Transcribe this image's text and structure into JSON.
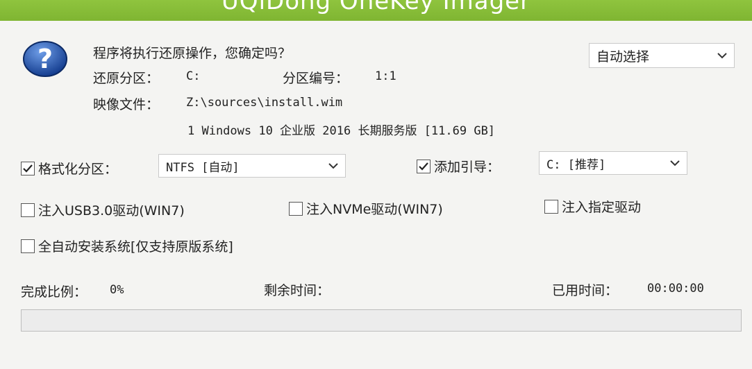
{
  "window": {
    "title": "UQiDong OneKey Imager"
  },
  "dialog": {
    "icon": "question-icon",
    "question": "程序将执行还原操作，您确定吗？",
    "restore_partition_label": "还原分区：",
    "restore_partition_value": "C:",
    "partition_number_label": "分区编号：",
    "partition_number_value": "1:1",
    "image_file_label": "映像文件：",
    "image_file_value": "Z:\\sources\\install.wim",
    "image_detail": "1 Windows 10 企业版 2016 长期服务版 [11.69 GB]",
    "auto_select": {
      "value": "自动选择"
    }
  },
  "options": {
    "format_partition": {
      "label": "格式化分区：",
      "checked": true,
      "select_value": "NTFS [自动]"
    },
    "add_boot": {
      "label": "添加引导：",
      "checked": true,
      "select_value": "C: [推荐]"
    },
    "inject_usb3": {
      "label": "注入USB3.0驱动(WIN7)",
      "checked": false
    },
    "inject_nvme": {
      "label": "注入NVMe驱动(WIN7)",
      "checked": false
    },
    "inject_custom": {
      "label": "注入指定驱动",
      "checked": false
    },
    "auto_install": {
      "label": "全自动安装系统[仅支持原版系统]",
      "checked": false
    }
  },
  "status": {
    "completion_label": "完成比例：",
    "completion_value": "0%",
    "remaining_label": "剩余时间：",
    "remaining_value": "",
    "elapsed_label": "已用时间：",
    "elapsed_value": "00:00:00",
    "progress_percent": 0
  },
  "colors": {
    "titlebar": "#8fc43e",
    "progress_fill": "#06b025",
    "icon_blue": "#1f4fa8"
  }
}
